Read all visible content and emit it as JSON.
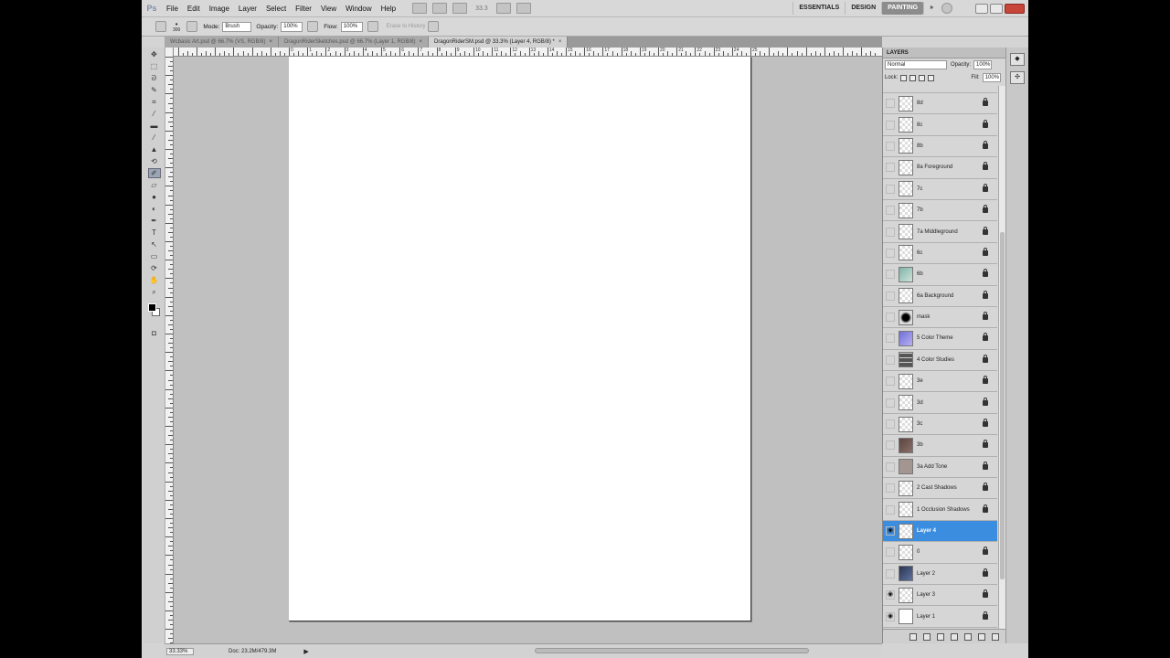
{
  "app": {
    "logo": "Ps"
  },
  "menu": [
    "File",
    "Edit",
    "Image",
    "Layer",
    "Select",
    "Filter",
    "View",
    "Window",
    "Help"
  ],
  "menubar": {
    "zoom": "33.3",
    "workspaces": [
      "ESSENTIALS",
      "DESIGN",
      "PAINTING"
    ],
    "active_workspace": "PAINTING",
    "more": "»"
  },
  "options": {
    "brush_size": "300",
    "mode_label": "Mode:",
    "mode_value": "Brush",
    "opacity_label": "Opacity:",
    "opacity_value": "100%",
    "flow_label": "Flow:",
    "flow_value": "100%",
    "erase_history": "Erase to History"
  },
  "tabs": [
    {
      "label": "Wcbasic Art.psd @ 66.7% (VS, RGB/8)",
      "close": "×"
    },
    {
      "label": "DragonRiderSketches.psd @ 66.7% (Layer 1, RGB/8)",
      "close": "×"
    },
    {
      "label": "DragonRiderSM.psd @ 33.3% (Layer 4, RGB/8) *",
      "close": "×"
    }
  ],
  "ruler": {
    "h": [
      "0",
      "1",
      "2",
      "3",
      "4",
      "5",
      "6",
      "7",
      "8",
      "9",
      "10",
      "11",
      "12",
      "13",
      "14",
      "15",
      "16",
      "17",
      "18",
      "19",
      "20",
      "21",
      "22",
      "23",
      "24",
      "25"
    ]
  },
  "status": {
    "zoom": "33.33%",
    "doc": "Doc: 23.2M/479.3M"
  },
  "layers_panel": {
    "title": "LAYERS",
    "blend_mode": "Normal",
    "opacity_label": "Opacity:",
    "opacity_value": "100%",
    "lock_label": "Lock:",
    "fill_label": "Fill:",
    "fill_value": "100%",
    "layers": [
      {
        "name": "8d",
        "visible": false,
        "thumb": "transparent"
      },
      {
        "name": "8c",
        "visible": false,
        "thumb": "transparent"
      },
      {
        "name": "8b",
        "visible": false,
        "thumb": "transparent"
      },
      {
        "name": "8a Foreground",
        "visible": false,
        "thumb": "transparent"
      },
      {
        "name": "7c",
        "visible": false,
        "thumb": "transparent"
      },
      {
        "name": "7b",
        "visible": false,
        "thumb": "transparent"
      },
      {
        "name": "7a Middleground",
        "visible": false,
        "thumb": "transparent"
      },
      {
        "name": "6c",
        "visible": false,
        "thumb": "transparent"
      },
      {
        "name": "6b",
        "visible": false,
        "thumb": "teal"
      },
      {
        "name": "6a Background",
        "visible": false,
        "thumb": "transparent"
      },
      {
        "name": "mask",
        "visible": false,
        "thumb": "mask"
      },
      {
        "name": "5 Color Theme",
        "visible": false,
        "thumb": "purple"
      },
      {
        "name": "4 Color Studies",
        "visible": false,
        "thumb": "grid"
      },
      {
        "name": "3e",
        "visible": false,
        "thumb": "transparent"
      },
      {
        "name": "3d",
        "visible": false,
        "thumb": "transparent"
      },
      {
        "name": "3c",
        "visible": false,
        "thumb": "transparent"
      },
      {
        "name": "3b",
        "visible": false,
        "thumb": "brown"
      },
      {
        "name": "3a Add Tone",
        "visible": false,
        "thumb": "tone"
      },
      {
        "name": "2 Cast Shadows",
        "visible": false,
        "thumb": "transparent"
      },
      {
        "name": "1 Occlusion Shadows",
        "visible": false,
        "thumb": "transparent"
      },
      {
        "name": "Layer 4",
        "visible": true,
        "thumb": "transparent",
        "selected": true
      },
      {
        "name": "0",
        "visible": false,
        "thumb": "transparent"
      },
      {
        "name": "Layer 2",
        "visible": false,
        "thumb": "dark"
      },
      {
        "name": "Layer 3",
        "visible": true,
        "thumb": "transparent"
      },
      {
        "name": "Layer 1",
        "visible": true,
        "thumb": "white"
      }
    ]
  },
  "colors": {
    "selection": "#3b8de0",
    "canvas": "#ffffff",
    "workarea": "#c0c0c0"
  }
}
